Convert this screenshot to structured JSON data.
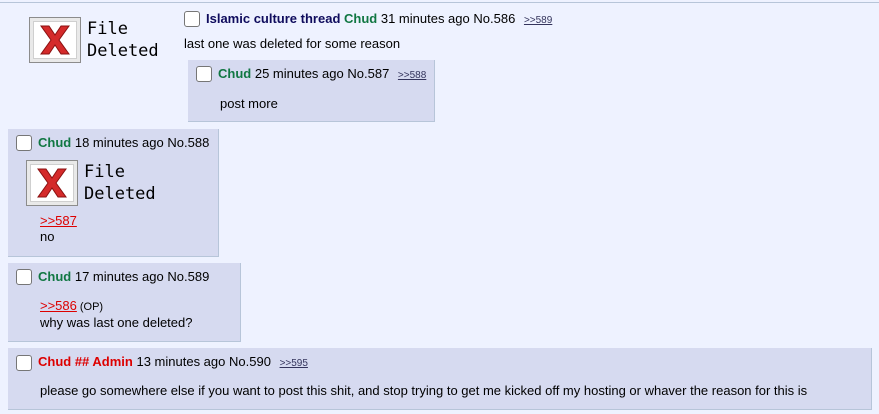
{
  "thread": {
    "op": {
      "file_deleted": "File\nDeleted",
      "subject": "Islamic culture thread",
      "name": "Chud",
      "time": "31 minutes ago",
      "number": "No.586",
      "backlinks": [
        ">>589"
      ],
      "message": "last one was deleted for some reason"
    },
    "replies": [
      {
        "name": "Chud",
        "time": "25 minutes ago",
        "number": "No.587",
        "backlink": ">>588",
        "message": "post more"
      },
      {
        "name": "Chud",
        "time": "18 minutes ago",
        "number": "No.588",
        "file_deleted": "File\nDeleted",
        "quote": ">>587",
        "message": "no"
      },
      {
        "name": "Chud",
        "time": "17 minutes ago",
        "number": "No.589",
        "quote": ">>586",
        "quote_tag": "(OP)",
        "message": "why was last one deleted?"
      },
      {
        "name": "Chud ## Admin",
        "time": "13 minutes ago",
        "number": "No.590",
        "backlink": ">>595",
        "message": "please go somewhere else if you want to post this shit, and stop trying to get me kicked off my hosting or whaver the reason for this is"
      }
    ]
  },
  "colors": {
    "background": "#eef2ff",
    "reply_bg": "#d6daf0",
    "subject": "#0f0c5d",
    "name": "#117743",
    "admin": "#dd0000",
    "quotelink": "#dd0000"
  }
}
